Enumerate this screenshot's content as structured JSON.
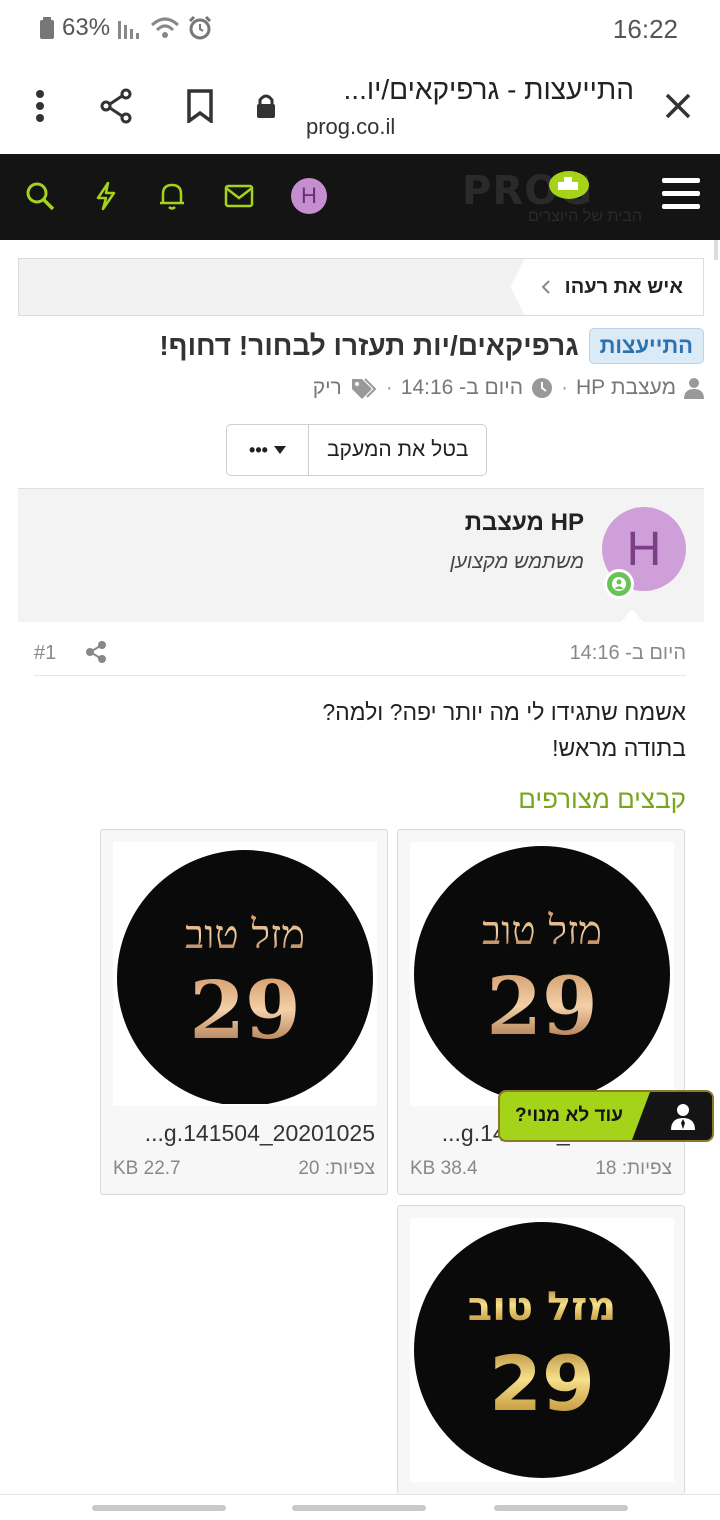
{
  "status_bar": {
    "battery": "63%",
    "time": "16:22"
  },
  "browser": {
    "title": "התייעצות - גרפיקאים/יו...",
    "domain": "prog.co.il"
  },
  "site_header": {
    "avatar_letter": "H",
    "logo_text": "PROG",
    "logo_tagline": "הבית של היוצרים",
    "accent_color": "#a4d31a"
  },
  "breadcrumb": {
    "label": "איש את רעהו"
  },
  "thread": {
    "prefix": "התייעצות",
    "title": "גרפיקאים/יות תעזרו לבחור! דחוף!",
    "author": "מעצבת HP",
    "date": "היום ב- 14:16",
    "tag": "ריק"
  },
  "actions": {
    "unwatch_label": "בטל את המעקב",
    "more_label": "•••"
  },
  "post": {
    "avatar_letter": "H",
    "username": "מעצבת HP",
    "user_title": "משתמש מקצוען",
    "date": "היום ב- 14:16",
    "number": "#1",
    "body_line1": "אשמח שתגידו לי מה יותר יפה? ולמה?",
    "body_line2": "בתודה מראש!"
  },
  "attachments": {
    "title": "קבצים מצורפים",
    "items": [
      {
        "image_text_top": "מזל טוב",
        "image_text_bottom": "29",
        "filename": "...g.141504_20201025",
        "size": "38.4 KB",
        "views": "צפיות: 18"
      },
      {
        "image_text_top": "מזל טוב",
        "image_text_bottom": "29",
        "filename": "...g.141504_20201025",
        "size": "22.7 KB",
        "views": "צפיות: 20"
      },
      {
        "image_text_top": "מזל טוב",
        "image_text_bottom": "29"
      }
    ]
  },
  "float_badge": {
    "label": "עוד לא מנוי?"
  }
}
